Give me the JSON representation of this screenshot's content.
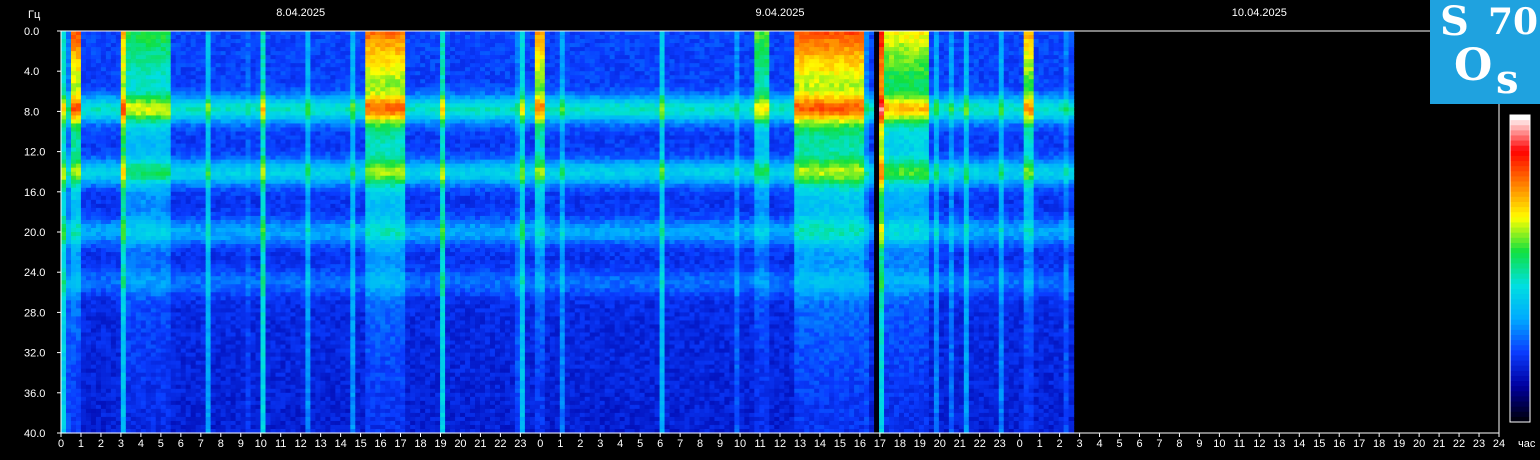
{
  "chart_data": {
    "type": "heatmap",
    "title": "",
    "ylabel": "Гц",
    "xlabel": "час",
    "ylim": [
      0,
      40
    ],
    "yticks": [
      "0.0",
      "4.0",
      "8.0",
      "12.0",
      "16.0",
      "20.0",
      "24.0",
      "28.0",
      "32.0",
      "36.0",
      "40.0"
    ],
    "dates": [
      "8.04.2025",
      "9.04.2025",
      "10.04.2025"
    ],
    "xticks": [
      0,
      1,
      2,
      3,
      4,
      5,
      6,
      7,
      8,
      9,
      10,
      11,
      12,
      13,
      14,
      15,
      16,
      17,
      18,
      19,
      20,
      21,
      22,
      23,
      0,
      1,
      2,
      3,
      4,
      5,
      6,
      7,
      8,
      9,
      10,
      11,
      12,
      13,
      14,
      15,
      16,
      17,
      18,
      19,
      20,
      21,
      22,
      23,
      0,
      1,
      2,
      3,
      4,
      5,
      6,
      7,
      8,
      9,
      10,
      11,
      12,
      13,
      14,
      15,
      16,
      17,
      18,
      19,
      20,
      21,
      22,
      23,
      24
    ],
    "x_range_hours": [
      0,
      72
    ],
    "data_end_hours": 50.7,
    "colorscale": [
      "#000010",
      "#0000a0",
      "#0a3cff",
      "#00aaff",
      "#00e0e0",
      "#10e040",
      "#ffff00",
      "#ff8000",
      "#ff0000",
      "#ffffff"
    ],
    "bands_hz": [
      {
        "freq": 7.8,
        "intensity": 0.55
      },
      {
        "freq": 14.1,
        "intensity": 0.45
      },
      {
        "freq": 20.0,
        "intensity": 0.3
      },
      {
        "freq": 25.0,
        "intensity": 0.18
      }
    ],
    "events": [
      {
        "start": 0.5,
        "end": 1.0,
        "intensity": 1.0
      },
      {
        "start": 3.0,
        "end": 5.5,
        "intensity": 0.55
      },
      {
        "start": 15.3,
        "end": 17.3,
        "intensity": 0.95
      },
      {
        "start": 23.8,
        "end": 24.3,
        "intensity": 0.9
      },
      {
        "start": 34.7,
        "end": 35.5,
        "intensity": 0.6
      },
      {
        "start": 36.8,
        "end": 40.3,
        "intensity": 1.0
      },
      {
        "start": 41.0,
        "end": 43.5,
        "intensity": 0.75
      },
      {
        "start": 48.3,
        "end": 48.8,
        "intensity": 0.85
      }
    ],
    "gap_hours": [
      40.6,
      40.85
    ]
  },
  "logo": {
    "text1": "S",
    "text2": "70",
    "text3": "O",
    "text4": "s"
  }
}
